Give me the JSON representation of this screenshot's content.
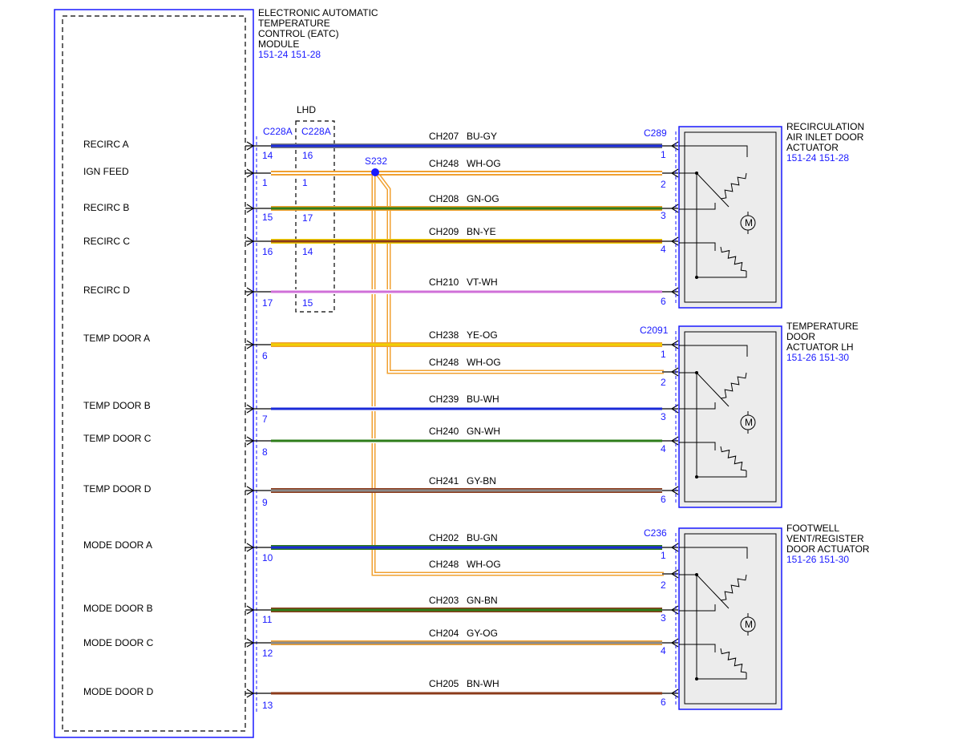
{
  "module": {
    "title_lines": [
      "ELECTRONIC AUTOMATIC",
      "TEMPERATURE",
      "CONTROL (EATC)",
      "MODULE"
    ],
    "refs": "151-24  151-28"
  },
  "lhd_label": "LHD",
  "connectors": {
    "module_side": "C228A",
    "lhd_side": "C228A",
    "splice": "S232"
  },
  "circuits": [
    {
      "signal": "RECIRC A",
      "circuit": "CH207",
      "color": "BU-GY",
      "module_pin": "14",
      "lhd_pin": "16",
      "act_pin": "1",
      "wire": [
        "#1a2ad8",
        "#7a7a7a"
      ]
    },
    {
      "signal": "IGN FEED",
      "circuit": "CH248",
      "color": "WH-OG",
      "module_pin": "1",
      "lhd_pin": "1",
      "act_pin": "2",
      "wire": [
        "#ffffff",
        "#f0a030"
      ]
    },
    {
      "signal": "RECIRC B",
      "circuit": "CH208",
      "color": "GN-OG",
      "module_pin": "15",
      "lhd_pin": "17",
      "act_pin": "3",
      "wire": [
        "#2e7d1a",
        "#f0a030"
      ]
    },
    {
      "signal": "RECIRC C",
      "circuit": "CH209",
      "color": "BN-YE",
      "module_pin": "16",
      "lhd_pin": "14",
      "act_pin": "4",
      "wire": [
        "#8b3a1a",
        "#f0d000"
      ]
    },
    {
      "signal": "RECIRC D",
      "circuit": "CH210",
      "color": "VT-WH",
      "module_pin": "17",
      "lhd_pin": "15",
      "act_pin": "6",
      "wire": [
        "#d070d8",
        "#ffffff"
      ]
    },
    {
      "signal": "TEMP DOOR A",
      "circuit": "CH238",
      "color": "YE-OG",
      "module_pin": "6",
      "act_pin": "1",
      "wire": [
        "#f0d000",
        "#f0a030"
      ]
    },
    {
      "signal": "",
      "circuit": "CH248",
      "color": "WH-OG",
      "module_pin": "",
      "act_pin": "2",
      "wire": [
        "#ffffff",
        "#f0a030"
      ]
    },
    {
      "signal": "TEMP DOOR B",
      "circuit": "CH239",
      "color": "BU-WH",
      "module_pin": "7",
      "act_pin": "3",
      "wire": [
        "#1a2ad8",
        "#ffffff"
      ]
    },
    {
      "signal": "TEMP DOOR C",
      "circuit": "CH240",
      "color": "GN-WH",
      "module_pin": "8",
      "act_pin": "4",
      "wire": [
        "#2e7d1a",
        "#ffffff"
      ]
    },
    {
      "signal": "TEMP DOOR D",
      "circuit": "CH241",
      "color": "GY-BN",
      "module_pin": "9",
      "act_pin": "6",
      "wire": [
        "#8a8a8a",
        "#8b3a1a"
      ]
    },
    {
      "signal": "MODE DOOR A",
      "circuit": "CH202",
      "color": "BU-GN",
      "module_pin": "10",
      "act_pin": "1",
      "wire": [
        "#1a2ad8",
        "#2e7d1a"
      ]
    },
    {
      "signal": "",
      "circuit": "CH248",
      "color": "WH-OG",
      "module_pin": "",
      "act_pin": "2",
      "wire": [
        "#ffffff",
        "#f0a030"
      ]
    },
    {
      "signal": "MODE DOOR B",
      "circuit": "CH203",
      "color": "GN-BN",
      "module_pin": "11",
      "act_pin": "3",
      "wire": [
        "#2e7d1a",
        "#8b3a1a"
      ]
    },
    {
      "signal": "MODE DOOR C",
      "circuit": "CH204",
      "color": "GY-OG",
      "module_pin": "12",
      "act_pin": "4",
      "wire": [
        "#8a8a8a",
        "#f0a030"
      ]
    },
    {
      "signal": "MODE DOOR D",
      "circuit": "CH205",
      "color": "BN-WH",
      "module_pin": "13",
      "act_pin": "6",
      "wire": [
        "#8b3a1a",
        "#ffffff"
      ]
    }
  ],
  "actuators": [
    {
      "connector": "C289",
      "title_lines": [
        "RECIRCULATION",
        "AIR INLET DOOR",
        "ACTUATOR"
      ],
      "refs": "151-24  151-28",
      "motor": "M"
    },
    {
      "connector": "C2091",
      "title_lines": [
        "TEMPERATURE",
        "DOOR",
        "ACTUATOR LH"
      ],
      "refs": "151-26  151-30",
      "motor": "M"
    },
    {
      "connector": "C236",
      "title_lines": [
        "FOOTWELL",
        "VENT/REGISTER",
        "DOOR ACTUATOR"
      ],
      "refs": "151-26  151-30",
      "motor": "M"
    }
  ],
  "colors": {
    "border_blue": "#1a1aff",
    "splice_blue": "#1a1aff"
  }
}
